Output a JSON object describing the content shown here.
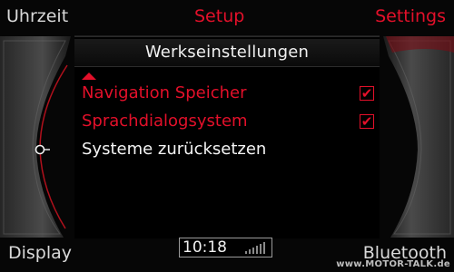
{
  "softkeys": {
    "top_left": "Uhrzeit",
    "top_center": "Setup",
    "top_right": "Settings",
    "bottom_left": "Display",
    "bottom_right": "Bluetooth"
  },
  "panel": {
    "title": "Werkseinstellungen",
    "items": [
      {
        "label": "Navigation Speicher",
        "checked": true,
        "state": "red"
      },
      {
        "label": "Sprachdialogsystem",
        "checked": true,
        "state": "red"
      },
      {
        "label": "Systeme zurücksetzen",
        "state": "selected"
      }
    ]
  },
  "status": {
    "time": "10:18",
    "signal_icon": "signal-bars-icon"
  },
  "watermark": "www.MOTOR-TALK.de",
  "colors": {
    "accent": "#e3102a",
    "text": "#f4f4f4",
    "background": "#000000"
  }
}
